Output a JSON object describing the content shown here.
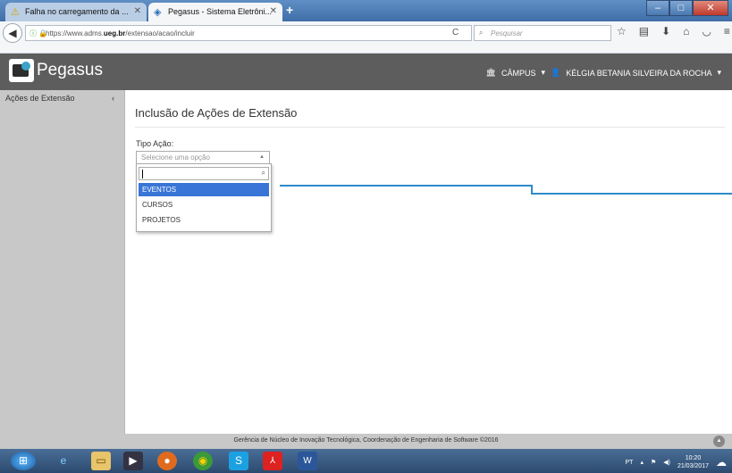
{
  "browser": {
    "tabs": [
      {
        "label": "Falha no carregamento da ...",
        "icon": "warning-icon"
      },
      {
        "label": "Pegasus - Sistema Eletrôni...",
        "icon": "pegasus-icon"
      }
    ],
    "url_prefix": "https://www.adms.",
    "url_domain": "ueg.br",
    "url_path": "/extensao/acao/incluir",
    "search_placeholder": "Pesquisar"
  },
  "app": {
    "logo_text": "Pegasus",
    "campus_label": "CÂMPUS",
    "user_name": "KÉLGIA BETANIA SILVEIRA DA ROCHA"
  },
  "sidebar": {
    "items": [
      {
        "label": "Ações de Extensão"
      }
    ]
  },
  "main": {
    "title": "Inclusão de Ações de Extensão",
    "field_label": "Tipo Ação:",
    "select_placeholder": "Selecione uma opção",
    "options": [
      "EVENTOS",
      "CURSOS",
      "PROJETOS"
    ],
    "highlighted_option": "EVENTOS"
  },
  "footer": {
    "text": "Gerência de Núcleo de Inovação Tecnológica, Coordenação de Engenharia de Software ©2016"
  },
  "taskbar": {
    "lang": "PT",
    "time": "10:20",
    "date": "21/03/2017"
  },
  "colors": {
    "header_bg": "#5d5d5d",
    "sidebar_bg": "#c8c8c8",
    "highlight": "#3875d7",
    "accent_line": "#2e8bc9"
  }
}
